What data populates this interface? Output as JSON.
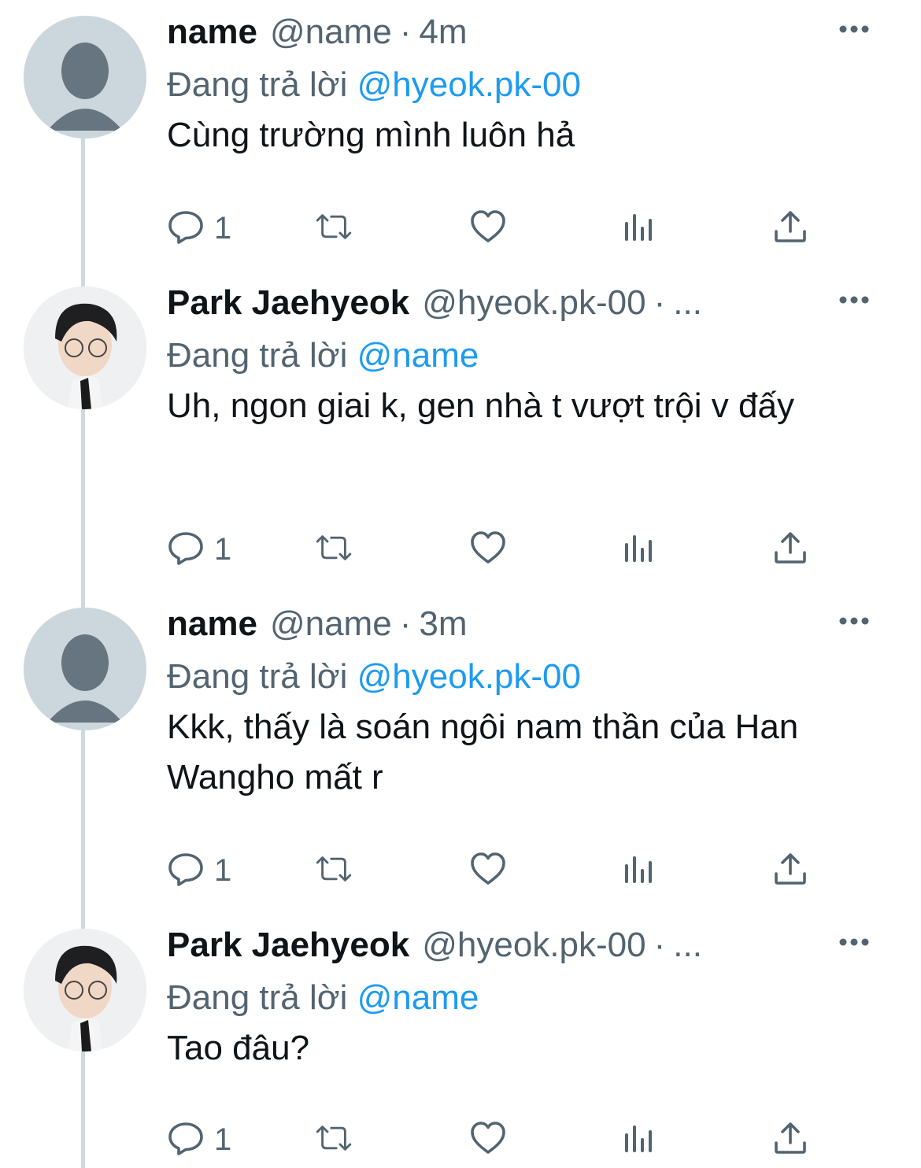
{
  "colors": {
    "accent": "#1d9bf0",
    "secondary": "#536471",
    "thread_line": "#cfd9de"
  },
  "tweets": [
    {
      "name": "name",
      "handle": "@name",
      "separator": "·",
      "time": "4m",
      "reply_prefix": "Đang trả lời",
      "reply_mention": "@hyeok.pk-00",
      "text": "Cùng trường mình luôn hả",
      "reply_count": "1",
      "avatar": "default-avatar"
    },
    {
      "name": "Park Jaehyeok",
      "handle": "@hyeok.pk-00",
      "separator": "·",
      "time": "...",
      "reply_prefix": "Đang trả lời",
      "reply_mention": "@name",
      "text": "Uh, ngon giai k, gen nhà t vượt trội v đấy",
      "reply_count": "1",
      "avatar": "photo-avatar"
    },
    {
      "name": "name",
      "handle": "@name",
      "separator": "·",
      "time": "3m",
      "reply_prefix": "Đang trả lời",
      "reply_mention": "@hyeok.pk-00",
      "text": "Kkk, thấy là soán ngôi nam thần của Han Wangho mất r",
      "reply_count": "1",
      "avatar": "default-avatar"
    },
    {
      "name": "Park Jaehyeok",
      "handle": "@hyeok.pk-00",
      "separator": "·",
      "time": "...",
      "reply_prefix": "Đang trả lời",
      "reply_mention": "@name",
      "text": "Tao đâu?",
      "reply_count": "1",
      "avatar": "photo-avatar"
    }
  ],
  "icons": [
    "reply-icon",
    "retweet-icon",
    "like-icon",
    "analytics-icon",
    "share-icon",
    "more-icon"
  ]
}
